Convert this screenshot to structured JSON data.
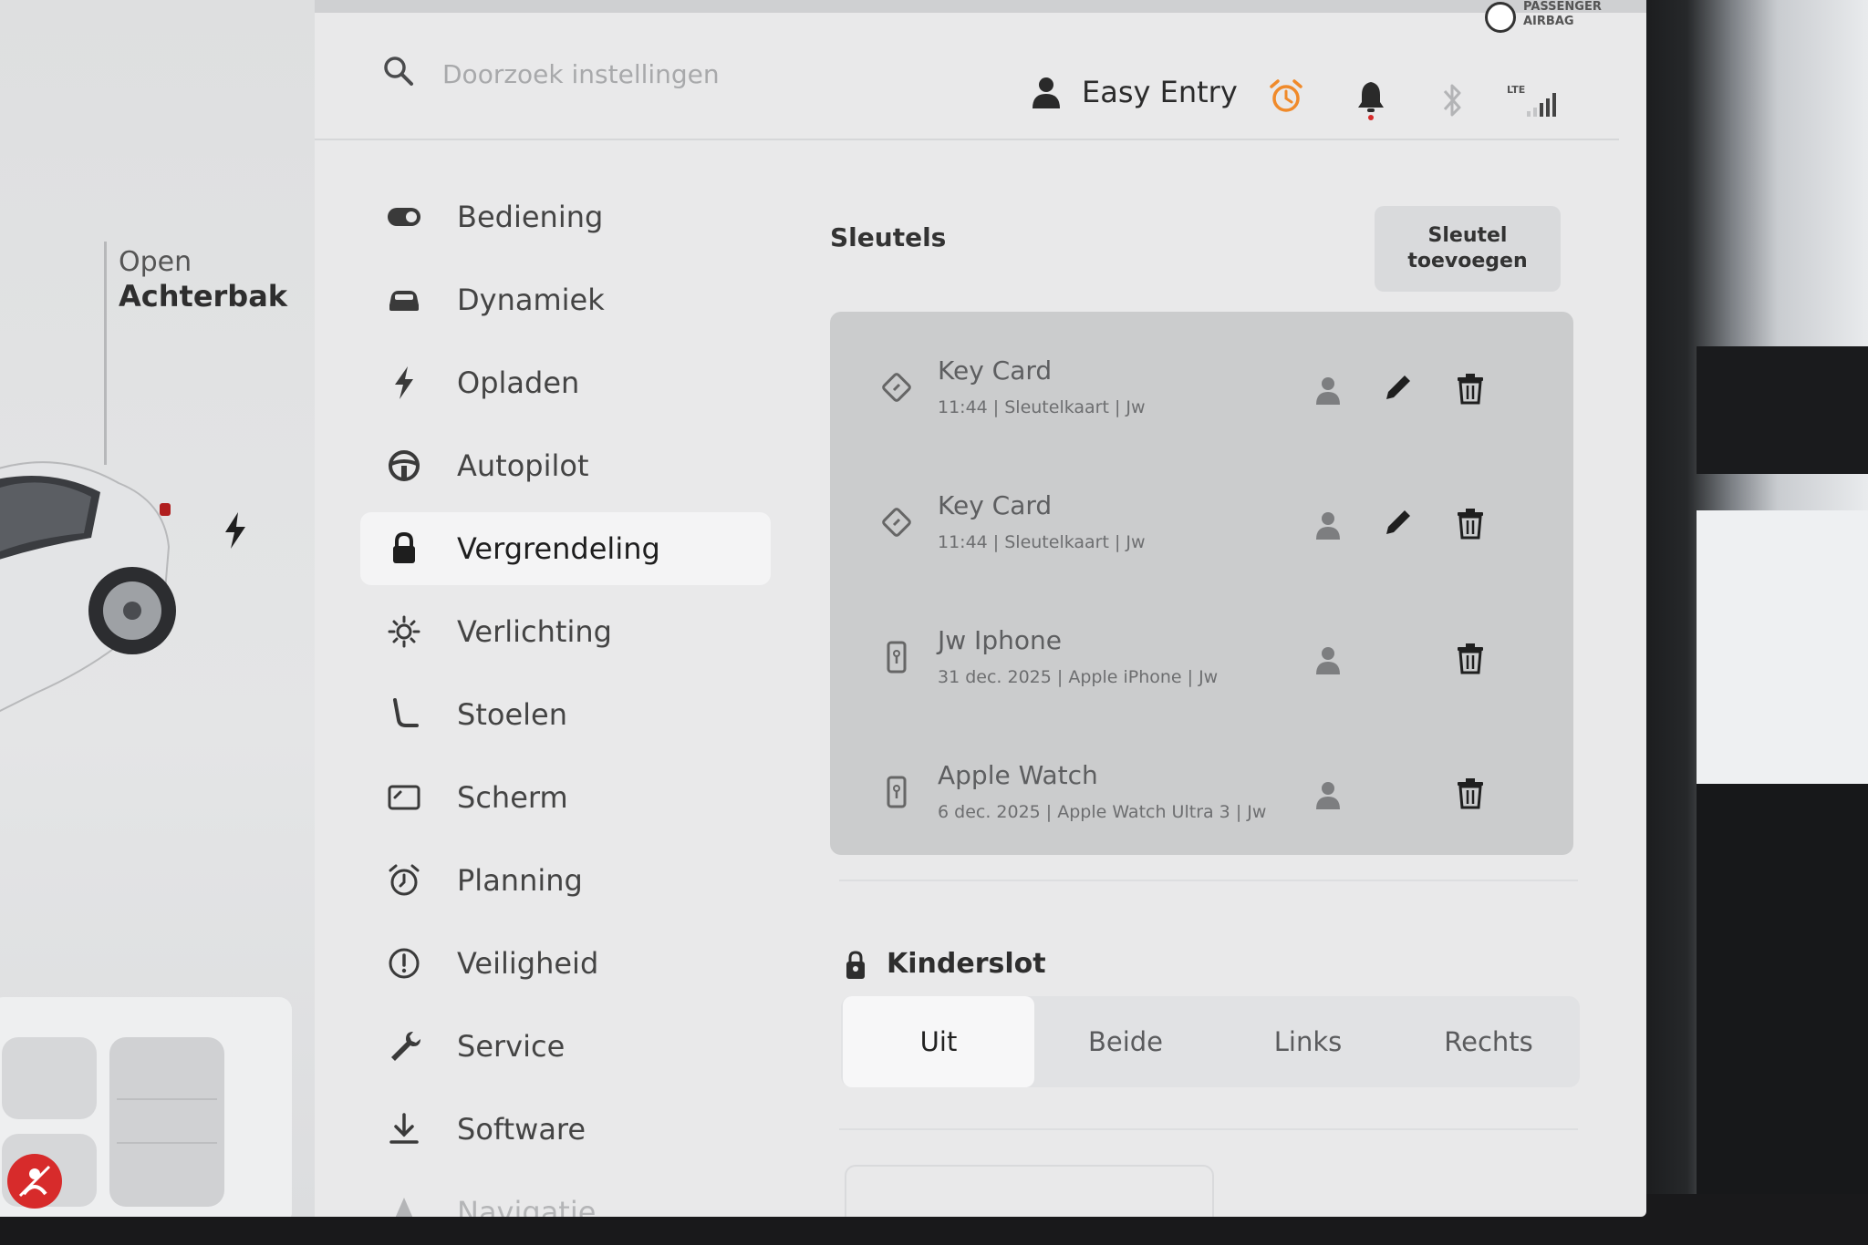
{
  "header": {
    "search_placeholder": "Doorzoek instellingen",
    "profile_name": "Easy Entry",
    "airbag_text_line1": "PASSENGER",
    "airbag_text_line2": "AIRBAG"
  },
  "left_panel": {
    "trunk_open": "Open",
    "trunk_label": "Achterbak"
  },
  "nav": {
    "items": [
      {
        "label": "Bediening",
        "icon": "toggle-icon"
      },
      {
        "label": "Dynamiek",
        "icon": "car-icon"
      },
      {
        "label": "Opladen",
        "icon": "bolt-icon"
      },
      {
        "label": "Autopilot",
        "icon": "steering-wheel-icon"
      },
      {
        "label": "Vergrendeling",
        "icon": "lock-icon",
        "active": true
      },
      {
        "label": "Verlichting",
        "icon": "light-icon"
      },
      {
        "label": "Stoelen",
        "icon": "seat-icon"
      },
      {
        "label": "Scherm",
        "icon": "display-icon"
      },
      {
        "label": "Planning",
        "icon": "alarm-clock-icon"
      },
      {
        "label": "Veiligheid",
        "icon": "alert-circle-icon"
      },
      {
        "label": "Service",
        "icon": "wrench-icon"
      },
      {
        "label": "Software",
        "icon": "download-icon"
      },
      {
        "label": "Navigatie",
        "icon": "navigation-icon"
      }
    ]
  },
  "keys": {
    "title": "Sleutels",
    "add_button_line1": "Sleutel",
    "add_button_line2": "toevoegen",
    "items": [
      {
        "name": "Key Card",
        "meta": "11:44 | Sleutelkaart | Jw",
        "type": "card",
        "editable": true
      },
      {
        "name": "Key Card",
        "meta": "11:44 | Sleutelkaart | Jw",
        "type": "card",
        "editable": true
      },
      {
        "name": "Jw Iphone",
        "meta": "31 dec. 2025 | Apple iPhone | Jw",
        "type": "phone",
        "editable": false
      },
      {
        "name": "Apple Watch",
        "meta": "6 dec. 2025 | Apple Watch Ultra 3 | Jw",
        "type": "phone",
        "editable": false
      }
    ]
  },
  "child_lock": {
    "title": "Kinderslot",
    "options": [
      "Uit",
      "Beide",
      "Links",
      "Rechts"
    ],
    "selected": "Uit"
  },
  "colors": {
    "alarm_orange": "#f08a2a",
    "notification_red": "#d72b2b",
    "screen_bg": "#e9e9ea",
    "key_list_bg": "#cbcccd"
  }
}
